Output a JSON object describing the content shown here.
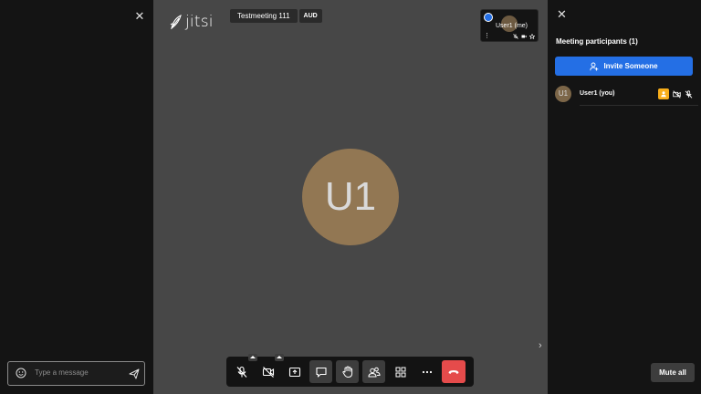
{
  "chat": {
    "placeholder": "Type a message",
    "close_icon": "close-icon",
    "emoji_icon": "emoji-icon",
    "send_icon": "send-icon"
  },
  "stage": {
    "logo_text": "jitsi",
    "meeting_title": "Testmeeting 111",
    "audio_badge": "AUD",
    "avatar_initials": "U1"
  },
  "thumbnail": {
    "name": "User1 (me)",
    "menu_glyph": "⋮"
  },
  "toolbar": {
    "buttons": [
      {
        "name": "microphone-muted",
        "icon": "mic-off-icon"
      },
      {
        "name": "camera-off",
        "icon": "camera-off-icon"
      },
      {
        "name": "screen-share",
        "icon": "screen-share-icon"
      },
      {
        "name": "chat",
        "icon": "chat-icon"
      },
      {
        "name": "raise-hand",
        "icon": "hand-icon"
      },
      {
        "name": "participants",
        "icon": "participants-icon"
      },
      {
        "name": "tile-view",
        "icon": "tile-view-icon"
      },
      {
        "name": "more",
        "icon": "more-icon"
      },
      {
        "name": "hangup",
        "icon": "hangup-icon"
      }
    ]
  },
  "participants": {
    "title": "Meeting participants (1)",
    "invite_label": "Invite Someone",
    "list": [
      {
        "initials": "U1",
        "name": "User1 (you)"
      }
    ],
    "mute_all_label": "Mute all"
  },
  "colors": {
    "accent": "#246fe5",
    "hangup": "#e54b4b",
    "avatar": "#927753",
    "moderator": "#f8ae1a"
  }
}
